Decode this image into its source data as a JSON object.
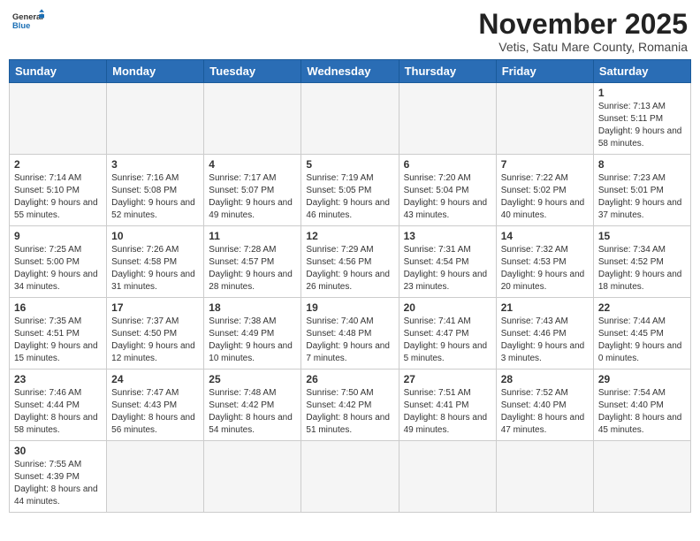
{
  "header": {
    "logo_general": "General",
    "logo_blue": "Blue",
    "month_title": "November 2025",
    "subtitle": "Vetis, Satu Mare County, Romania"
  },
  "weekdays": [
    "Sunday",
    "Monday",
    "Tuesday",
    "Wednesday",
    "Thursday",
    "Friday",
    "Saturday"
  ],
  "weeks": [
    [
      {
        "day": "",
        "info": ""
      },
      {
        "day": "",
        "info": ""
      },
      {
        "day": "",
        "info": ""
      },
      {
        "day": "",
        "info": ""
      },
      {
        "day": "",
        "info": ""
      },
      {
        "day": "",
        "info": ""
      },
      {
        "day": "1",
        "info": "Sunrise: 7:13 AM\nSunset: 5:11 PM\nDaylight: 9 hours\nand 58 minutes."
      }
    ],
    [
      {
        "day": "2",
        "info": "Sunrise: 7:14 AM\nSunset: 5:10 PM\nDaylight: 9 hours\nand 55 minutes."
      },
      {
        "day": "3",
        "info": "Sunrise: 7:16 AM\nSunset: 5:08 PM\nDaylight: 9 hours\nand 52 minutes."
      },
      {
        "day": "4",
        "info": "Sunrise: 7:17 AM\nSunset: 5:07 PM\nDaylight: 9 hours\nand 49 minutes."
      },
      {
        "day": "5",
        "info": "Sunrise: 7:19 AM\nSunset: 5:05 PM\nDaylight: 9 hours\nand 46 minutes."
      },
      {
        "day": "6",
        "info": "Sunrise: 7:20 AM\nSunset: 5:04 PM\nDaylight: 9 hours\nand 43 minutes."
      },
      {
        "day": "7",
        "info": "Sunrise: 7:22 AM\nSunset: 5:02 PM\nDaylight: 9 hours\nand 40 minutes."
      },
      {
        "day": "8",
        "info": "Sunrise: 7:23 AM\nSunset: 5:01 PM\nDaylight: 9 hours\nand 37 minutes."
      }
    ],
    [
      {
        "day": "9",
        "info": "Sunrise: 7:25 AM\nSunset: 5:00 PM\nDaylight: 9 hours\nand 34 minutes."
      },
      {
        "day": "10",
        "info": "Sunrise: 7:26 AM\nSunset: 4:58 PM\nDaylight: 9 hours\nand 31 minutes."
      },
      {
        "day": "11",
        "info": "Sunrise: 7:28 AM\nSunset: 4:57 PM\nDaylight: 9 hours\nand 28 minutes."
      },
      {
        "day": "12",
        "info": "Sunrise: 7:29 AM\nSunset: 4:56 PM\nDaylight: 9 hours\nand 26 minutes."
      },
      {
        "day": "13",
        "info": "Sunrise: 7:31 AM\nSunset: 4:54 PM\nDaylight: 9 hours\nand 23 minutes."
      },
      {
        "day": "14",
        "info": "Sunrise: 7:32 AM\nSunset: 4:53 PM\nDaylight: 9 hours\nand 20 minutes."
      },
      {
        "day": "15",
        "info": "Sunrise: 7:34 AM\nSunset: 4:52 PM\nDaylight: 9 hours\nand 18 minutes."
      }
    ],
    [
      {
        "day": "16",
        "info": "Sunrise: 7:35 AM\nSunset: 4:51 PM\nDaylight: 9 hours\nand 15 minutes."
      },
      {
        "day": "17",
        "info": "Sunrise: 7:37 AM\nSunset: 4:50 PM\nDaylight: 9 hours\nand 12 minutes."
      },
      {
        "day": "18",
        "info": "Sunrise: 7:38 AM\nSunset: 4:49 PM\nDaylight: 9 hours\nand 10 minutes."
      },
      {
        "day": "19",
        "info": "Sunrise: 7:40 AM\nSunset: 4:48 PM\nDaylight: 9 hours\nand 7 minutes."
      },
      {
        "day": "20",
        "info": "Sunrise: 7:41 AM\nSunset: 4:47 PM\nDaylight: 9 hours\nand 5 minutes."
      },
      {
        "day": "21",
        "info": "Sunrise: 7:43 AM\nSunset: 4:46 PM\nDaylight: 9 hours\nand 3 minutes."
      },
      {
        "day": "22",
        "info": "Sunrise: 7:44 AM\nSunset: 4:45 PM\nDaylight: 9 hours\nand 0 minutes."
      }
    ],
    [
      {
        "day": "23",
        "info": "Sunrise: 7:46 AM\nSunset: 4:44 PM\nDaylight: 8 hours\nand 58 minutes."
      },
      {
        "day": "24",
        "info": "Sunrise: 7:47 AM\nSunset: 4:43 PM\nDaylight: 8 hours\nand 56 minutes."
      },
      {
        "day": "25",
        "info": "Sunrise: 7:48 AM\nSunset: 4:42 PM\nDaylight: 8 hours\nand 54 minutes."
      },
      {
        "day": "26",
        "info": "Sunrise: 7:50 AM\nSunset: 4:42 PM\nDaylight: 8 hours\nand 51 minutes."
      },
      {
        "day": "27",
        "info": "Sunrise: 7:51 AM\nSunset: 4:41 PM\nDaylight: 8 hours\nand 49 minutes."
      },
      {
        "day": "28",
        "info": "Sunrise: 7:52 AM\nSunset: 4:40 PM\nDaylight: 8 hours\nand 47 minutes."
      },
      {
        "day": "29",
        "info": "Sunrise: 7:54 AM\nSunset: 4:40 PM\nDaylight: 8 hours\nand 45 minutes."
      }
    ],
    [
      {
        "day": "30",
        "info": "Sunrise: 7:55 AM\nSunset: 4:39 PM\nDaylight: 8 hours\nand 44 minutes."
      },
      {
        "day": "",
        "info": ""
      },
      {
        "day": "",
        "info": ""
      },
      {
        "day": "",
        "info": ""
      },
      {
        "day": "",
        "info": ""
      },
      {
        "day": "",
        "info": ""
      },
      {
        "day": "",
        "info": ""
      }
    ]
  ]
}
